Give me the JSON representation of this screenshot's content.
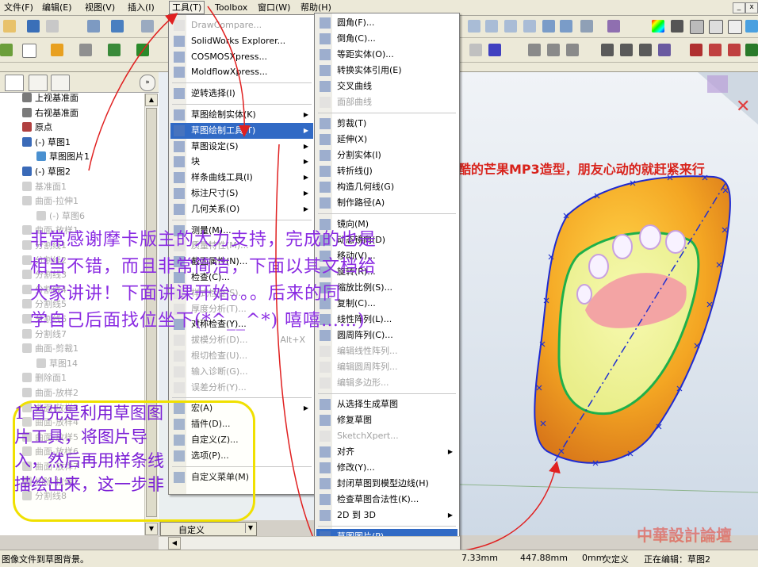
{
  "menubar": {
    "items": [
      "文件(F)",
      "编辑(E)",
      "视图(V)",
      "插入(I)",
      "工具(T)",
      "Toolbox",
      "窗口(W)",
      "帮助(H)"
    ],
    "open_index": 4
  },
  "tree": {
    "items": [
      {
        "label": "上视基准面",
        "dim": false
      },
      {
        "label": "右视基准面",
        "dim": false
      },
      {
        "label": "原点",
        "dim": false
      },
      {
        "label": "(-) 草图1",
        "dim": false
      },
      {
        "label": "草图图片1",
        "dim": false
      },
      {
        "label": "(-) 草图2",
        "dim": false
      },
      {
        "label": "基准面1",
        "dim": true
      },
      {
        "label": "曲面-拉伸1",
        "dim": true
      },
      {
        "label": "(-) 草图6",
        "dim": true
      },
      {
        "label": "曲面-放样1",
        "dim": true
      },
      {
        "label": "分割线1",
        "dim": true
      },
      {
        "label": "分割线2",
        "dim": true
      },
      {
        "label": "分割线3",
        "dim": true
      },
      {
        "label": "分割线4",
        "dim": true
      },
      {
        "label": "分割线5",
        "dim": true
      },
      {
        "label": "分割线6",
        "dim": true
      },
      {
        "label": "分割线7",
        "dim": true
      },
      {
        "label": "曲面-剪裁1",
        "dim": true
      },
      {
        "label": "草图14",
        "dim": true
      },
      {
        "label": "删除面1",
        "dim": true
      },
      {
        "label": "曲面-放样2",
        "dim": true
      },
      {
        "label": "曲面-放样3",
        "dim": true
      },
      {
        "label": "曲面-放样4",
        "dim": true
      },
      {
        "label": "曲面-放样5",
        "dim": true
      },
      {
        "label": "曲面-放样6",
        "dim": true
      },
      {
        "label": "曲面-放样7",
        "dim": true
      },
      {
        "label": "切除-拉伸1",
        "dim": true
      },
      {
        "label": "分割线8",
        "dim": true
      }
    ]
  },
  "tools_menu": {
    "items": [
      {
        "label": "DrawCompare...",
        "dis": true
      },
      {
        "label": "SolidWorks Explorer...",
        "dis": false
      },
      {
        "label": "COSMOSXpress...",
        "dis": false
      },
      {
        "label": "MoldflowXpress...",
        "dis": false
      },
      {
        "label": "逆转选择(I)",
        "dis": false
      },
      {
        "label": "草图绘制实体(K)",
        "dis": false,
        "sub": true
      },
      {
        "label": "草图绘制工具(T)",
        "dis": false,
        "sub": true,
        "hl": true
      },
      {
        "label": "草图设定(S)",
        "dis": false,
        "sub": true
      },
      {
        "label": "块",
        "dis": false,
        "sub": true
      },
      {
        "label": "样条曲线工具(I)",
        "dis": false,
        "sub": true
      },
      {
        "label": "标注尺寸(S)",
        "dis": false,
        "sub": true
      },
      {
        "label": "几何关系(O)",
        "dis": false,
        "sub": true
      },
      {
        "label": "测量(M)...",
        "dis": false
      },
      {
        "label": "质量特性(M)...",
        "dis": true
      },
      {
        "label": "截面属性(N)...",
        "dis": false
      },
      {
        "label": "检查(C)...",
        "dis": false
      },
      {
        "label": "样式检查(S)...",
        "dis": true
      },
      {
        "label": "厚度分析(T)...",
        "dis": true
      },
      {
        "label": "对称检查(Y)...",
        "dis": false
      },
      {
        "label": "拔模分析(D)...",
        "dis": true,
        "accel": "Alt+X"
      },
      {
        "label": "根切检查(U)...",
        "dis": true
      },
      {
        "label": "输入诊断(G)...",
        "dis": true
      },
      {
        "label": "误差分析(Y)...",
        "dis": true
      },
      {
        "label": "宏(A)",
        "dis": false,
        "sub": true
      },
      {
        "label": "插件(D)...",
        "dis": false
      },
      {
        "label": "自定义(Z)...",
        "dis": false
      },
      {
        "label": "选项(P)...",
        "dis": false
      },
      {
        "label": "自定义菜单(M)",
        "dis": false
      }
    ]
  },
  "submenu": {
    "items": [
      {
        "label": "圆角(F)...",
        "dis": false
      },
      {
        "label": "倒角(C)...",
        "dis": false
      },
      {
        "label": "等距实体(O)...",
        "dis": false
      },
      {
        "label": "转换实体引用(E)",
        "dis": false
      },
      {
        "label": "交叉曲线",
        "dis": false
      },
      {
        "label": "面部曲线",
        "dis": true
      },
      {
        "label": "剪裁(T)",
        "dis": false
      },
      {
        "label": "延伸(X)",
        "dis": false
      },
      {
        "label": "分割实体(I)",
        "dis": false
      },
      {
        "label": "转折线(J)",
        "dis": false
      },
      {
        "label": "构造几何线(G)",
        "dis": false
      },
      {
        "label": "制作路径(A)",
        "dis": false
      },
      {
        "label": "镜向(M)",
        "dis": false
      },
      {
        "label": "动态镜向(D)",
        "dis": false
      },
      {
        "label": "移动(V)...",
        "dis": false
      },
      {
        "label": "旋转(R)...",
        "dis": false
      },
      {
        "label": "缩放比例(S)...",
        "dis": false
      },
      {
        "label": "复制(C)...",
        "dis": false
      },
      {
        "label": "线性阵列(L)...",
        "dis": false
      },
      {
        "label": "圆周阵列(C)...",
        "dis": false
      },
      {
        "label": "编辑线性阵列...",
        "dis": true
      },
      {
        "label": "编辑圆周阵列...",
        "dis": true
      },
      {
        "label": "编辑多边形...",
        "dis": true
      },
      {
        "label": "从选择生成草图",
        "dis": false
      },
      {
        "label": "修复草图",
        "dis": false
      },
      {
        "label": "SketchXpert...",
        "dis": true
      },
      {
        "label": "对齐",
        "dis": false,
        "sub": true
      },
      {
        "label": "修改(Y)...",
        "dis": false
      },
      {
        "label": "封闭草图到模型边线(H)",
        "dis": false
      },
      {
        "label": "检查草图合法性(K)...",
        "dis": false
      },
      {
        "label": "2D 到 3D",
        "dis": false,
        "sub": true
      },
      {
        "label": "草图图片(P)...",
        "dis": false,
        "hl": true
      }
    ]
  },
  "overlay": {
    "line1": "非常感谢摩卡版主的大力支持，完成的也是",
    "line2": "相当不错，而且非常简洁，下面以其文档给",
    "line3": "大家讲讲！下面讲课开始。。。后来的同",
    "line4": "学自己后面找位坐下(*^__^*) 嘻嘻……)"
  },
  "callout": {
    "line1": "1 首先是利用草图图",
    "line2": "片工具，将图片导",
    "line3": "入，然后再用样条线",
    "line4": "描绘出来，这一步非"
  },
  "viewport_caption": "酷的芒果MP3造型，朋友心动的就赶紧来行",
  "bottom_combo": "自定义",
  "status": {
    "hint": "图像文件到草图背景。",
    "x": "7.33mm",
    "y": "447.88mm",
    "z": "0mm",
    "state": "欠定义",
    "editing": "正在编辑：草图2"
  },
  "watermark": "中華設計論壇",
  "colors": {
    "highlight": "#316ac5",
    "overlay_text": "#8a2be2",
    "callout_border": "#f0e000",
    "arrow": "#e02020",
    "mango_body": "#f4a623",
    "outline": "#2020d0"
  }
}
